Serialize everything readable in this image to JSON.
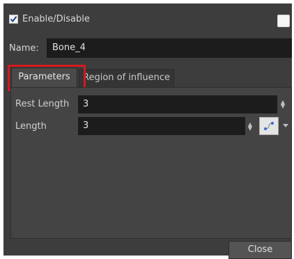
{
  "header": {
    "enable_label": "Enable/Disable",
    "enable_checked": true
  },
  "name": {
    "label": "Name:",
    "value": "Bone_4"
  },
  "tabs": [
    {
      "label": "Parameters",
      "active": true
    },
    {
      "label": "Region of influence",
      "active": false
    }
  ],
  "parameters": {
    "rest_length": {
      "label": "Rest Length",
      "value": "3"
    },
    "length": {
      "label": "Length",
      "value": "3"
    }
  },
  "footer": {
    "close_label": "Close"
  },
  "colors": {
    "panel_bg": "#3d3d3d",
    "field_bg": "#1c1c1c",
    "highlight": "#d7191c"
  },
  "icons": {
    "spin": "spin-arrows-icon",
    "function": "function-curve-icon",
    "dropdown": "chevron-down-icon"
  }
}
